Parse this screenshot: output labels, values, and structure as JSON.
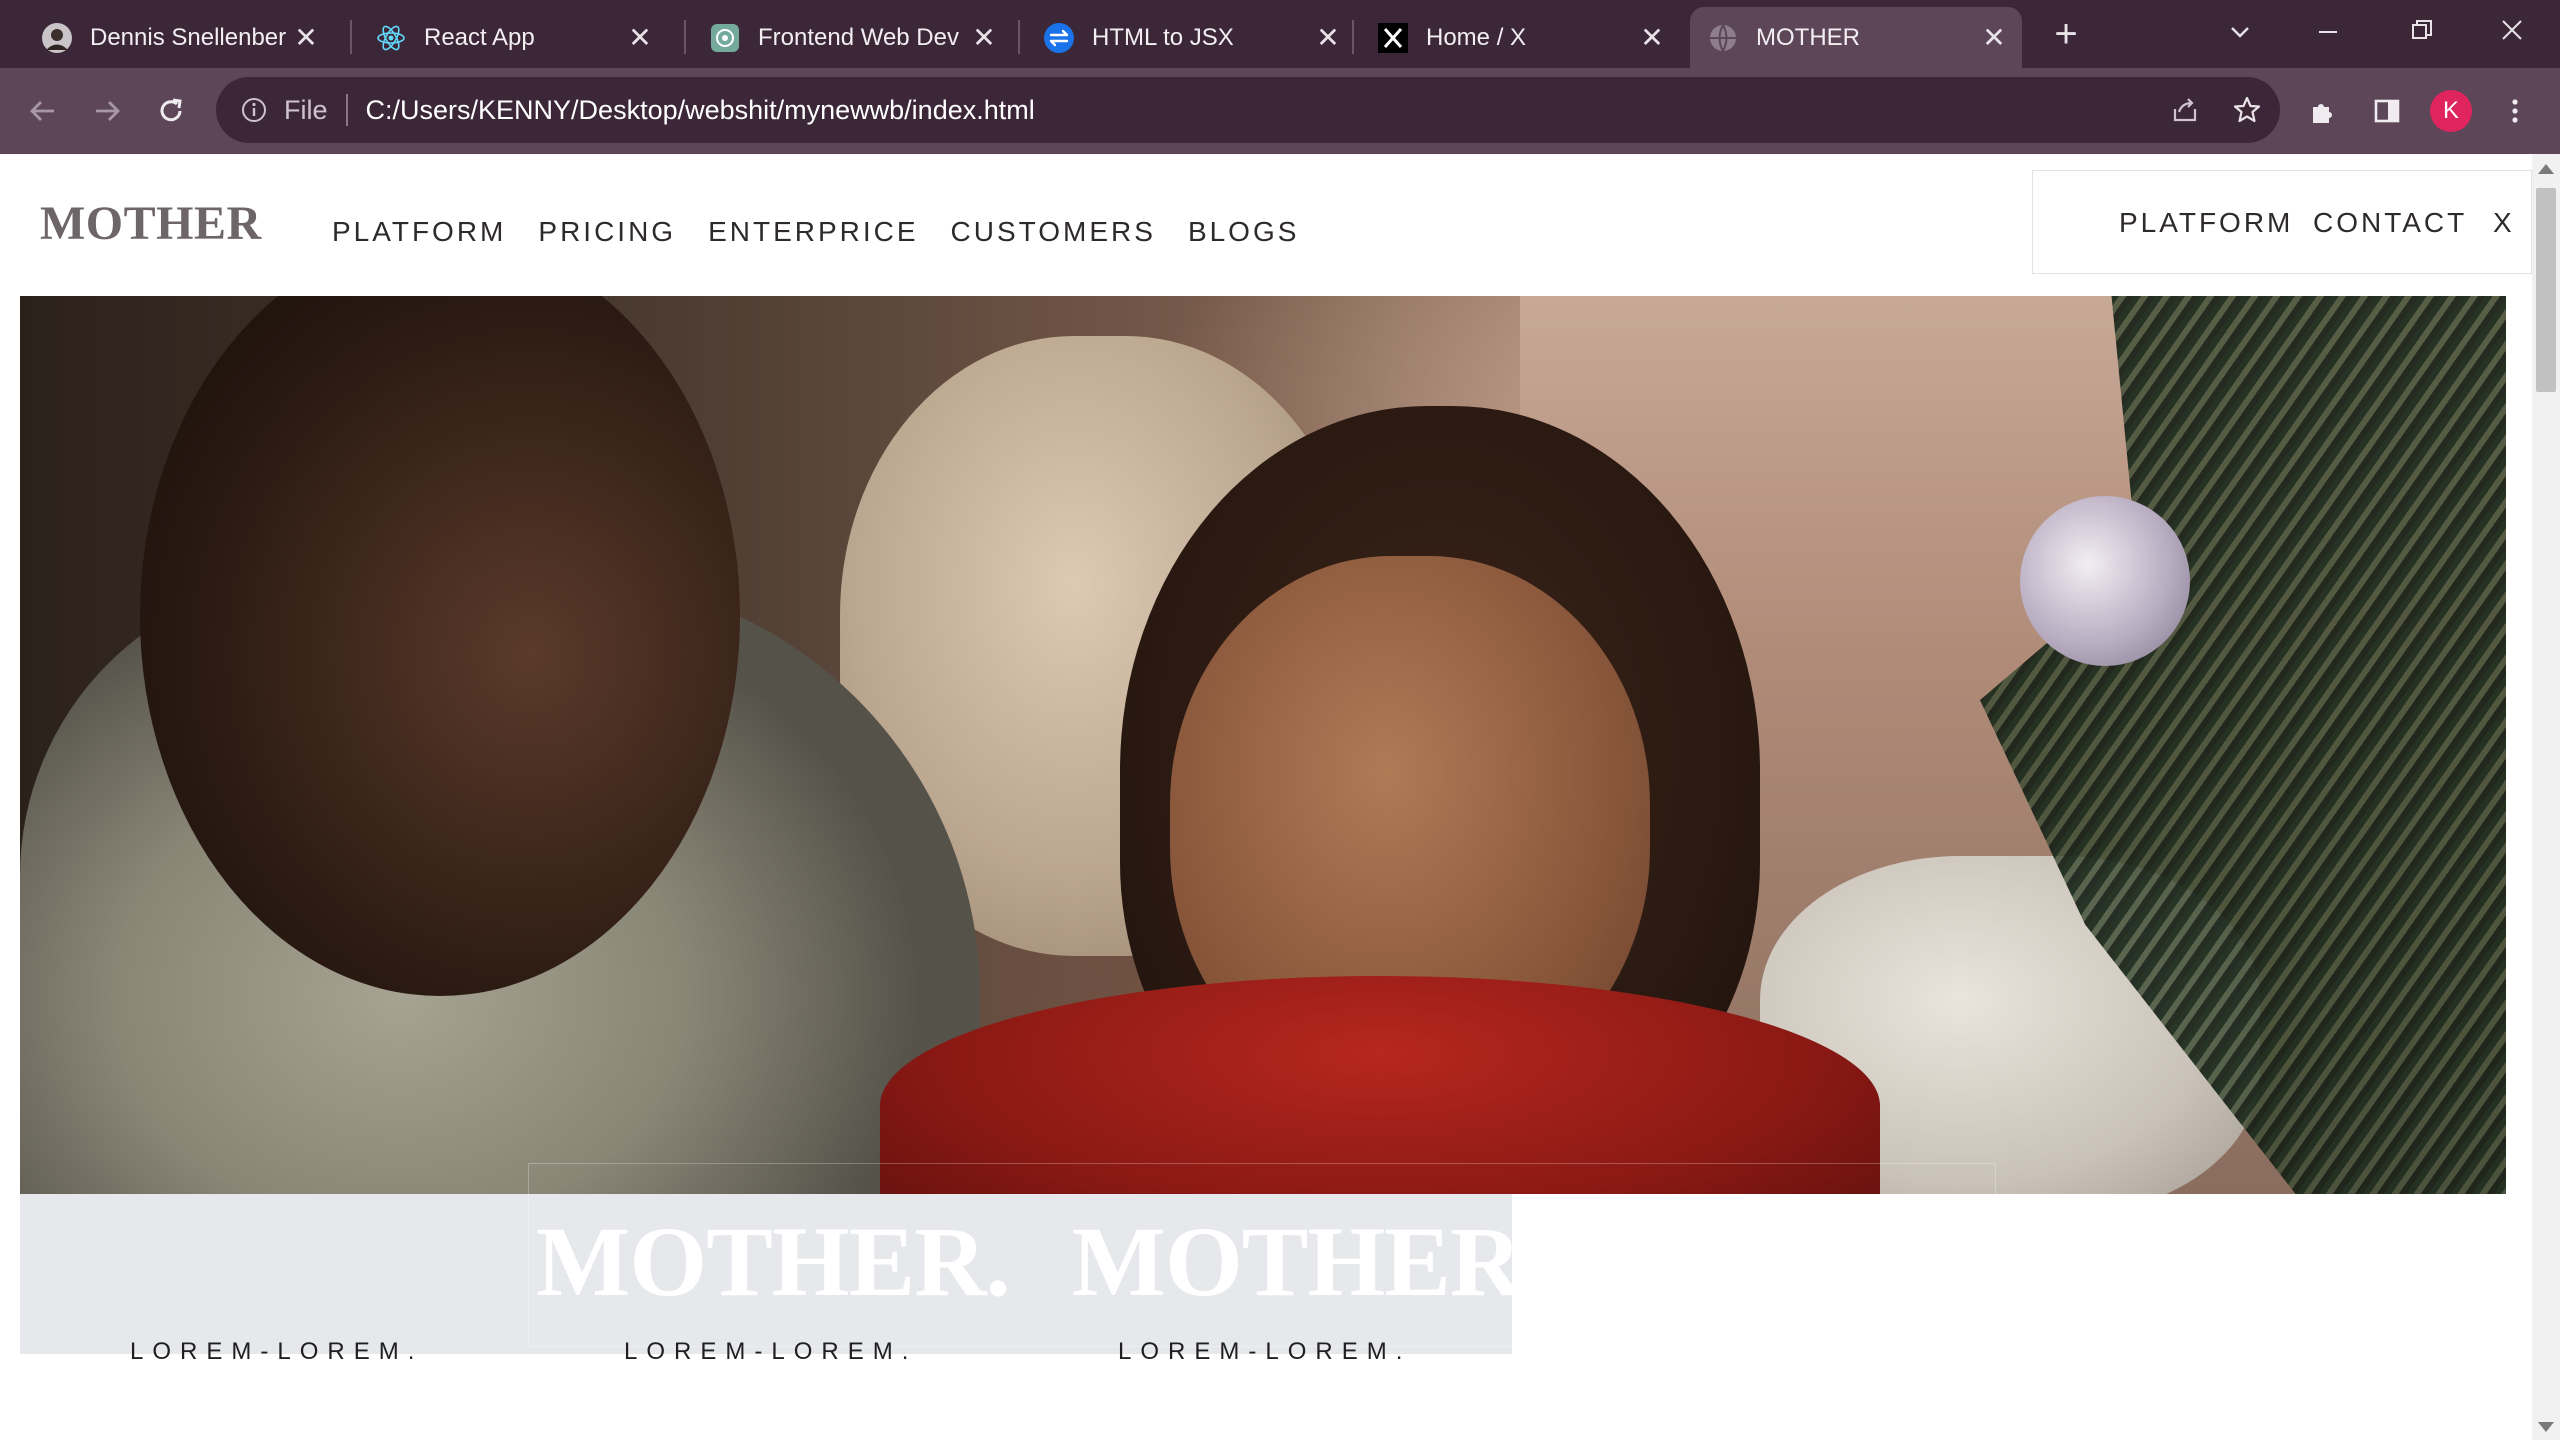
{
  "browser": {
    "tabs": [
      {
        "title": "Dennis Snellenberg",
        "icon": "avatar-icon",
        "active": false
      },
      {
        "title": "React App",
        "icon": "react-icon",
        "active": false
      },
      {
        "title": "Frontend Web Dev",
        "icon": "openai-icon",
        "active": false
      },
      {
        "title": "HTML to JSX",
        "icon": "transform-icon",
        "active": false
      },
      {
        "title": "Home / X",
        "icon": "x-logo-icon",
        "active": false
      },
      {
        "title": "MOTHER",
        "icon": "globe-icon",
        "active": true
      }
    ],
    "close_glyph": "✕",
    "new_tab_glyph": "+",
    "address": {
      "scheme_label": "File",
      "url": "C:/Users/KENNY/Desktop/webshit/mynewwb/index.html"
    },
    "profile_initial": "K",
    "colors": {
      "tabstrip": "#3b2738",
      "toolbar": "#5c4658",
      "profile": "#e0245e"
    }
  },
  "page": {
    "brand": "MOTHER",
    "nav": [
      "PLATFORM",
      "PRICING",
      "ENTERPRICE",
      "CUSTOMERS",
      "BLOGS"
    ],
    "side_menu": {
      "items": [
        "PLATFORM",
        "CONTACT"
      ],
      "close": "X"
    },
    "hero_words": [
      "MOTHER.",
      "MOTHER.",
      "MOTHER."
    ],
    "lorem": [
      "LOREM-LOREM.",
      "LOREM-LOREM.",
      "LOREM-LOREM."
    ]
  }
}
